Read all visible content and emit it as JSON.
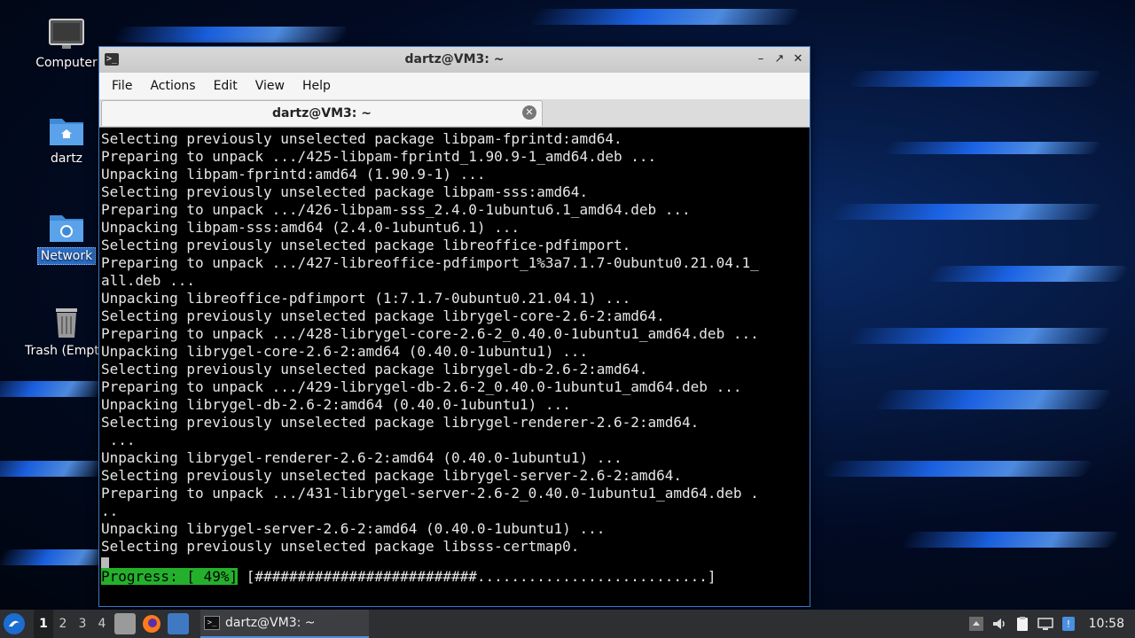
{
  "desktop": {
    "icons": [
      {
        "label": "Computer",
        "icon": "monitor-icon"
      },
      {
        "label": "dartz",
        "icon": "home-folder-icon"
      },
      {
        "label": "Network",
        "icon": "network-folder-icon"
      },
      {
        "label": "Trash (Empty)",
        "icon": "trash-icon"
      }
    ]
  },
  "window": {
    "title": "dartz@VM3: ~",
    "menu": [
      "File",
      "Actions",
      "Edit",
      "View",
      "Help"
    ],
    "tab_title": "dartz@VM3: ~"
  },
  "terminal": {
    "lines": [
      "Selecting previously unselected package libpam-fprintd:amd64.",
      "Preparing to unpack .../425-libpam-fprintd_1.90.9-1_amd64.deb ...",
      "Unpacking libpam-fprintd:amd64 (1.90.9-1) ...",
      "Selecting previously unselected package libpam-sss:amd64.",
      "Preparing to unpack .../426-libpam-sss_2.4.0-1ubuntu6.1_amd64.deb ...",
      "Unpacking libpam-sss:amd64 (2.4.0-1ubuntu6.1) ...",
      "Selecting previously unselected package libreoffice-pdfimport.",
      "Preparing to unpack .../427-libreoffice-pdfimport_1%3a7.1.7-0ubuntu0.21.04.1_",
      "all.deb ...",
      "Unpacking libreoffice-pdfimport (1:7.1.7-0ubuntu0.21.04.1) ...",
      "Selecting previously unselected package librygel-core-2.6-2:amd64.",
      "Preparing to unpack .../428-librygel-core-2.6-2_0.40.0-1ubuntu1_amd64.deb ...",
      "Unpacking librygel-core-2.6-2:amd64 (0.40.0-1ubuntu1) ...",
      "Selecting previously unselected package librygel-db-2.6-2:amd64.",
      "Preparing to unpack .../429-librygel-db-2.6-2_0.40.0-1ubuntu1_amd64.deb ...",
      "Unpacking librygel-db-2.6-2:amd64 (0.40.0-1ubuntu1) ...",
      "Selecting previously unselected package librygel-renderer-2.6-2:amd64.",
      " ...",
      "Unpacking librygel-renderer-2.6-2:amd64 (0.40.0-1ubuntu1) ...",
      "Selecting previously unselected package librygel-server-2.6-2:amd64.",
      "Preparing to unpack .../431-librygel-server-2.6-2_0.40.0-1ubuntu1_amd64.deb .",
      "..",
      "Unpacking librygel-server-2.6-2:amd64 (0.40.0-1ubuntu1) ...",
      "Selecting previously unselected package libsss-certmap0."
    ],
    "progress_label": "Progress: [ 49%]",
    "progress_bar": " [##########################...........................]",
    "progress_fraction": 0.49
  },
  "taskbar": {
    "workspaces": [
      "1",
      "2",
      "3",
      "4"
    ],
    "active_workspace": "1",
    "launchers": [
      "file-manager-icon",
      "firefox-icon",
      "show-desktop-icon"
    ],
    "task_label": "dartz@VM3: ~",
    "tray_icons": [
      "tray-up-arrow-icon",
      "volume-icon",
      "clipboard-icon",
      "network-icon",
      "update-notifier-icon"
    ],
    "clock": "10:58"
  },
  "colors": {
    "accent": "#3a76c8",
    "progress_green": "#24b02c"
  }
}
